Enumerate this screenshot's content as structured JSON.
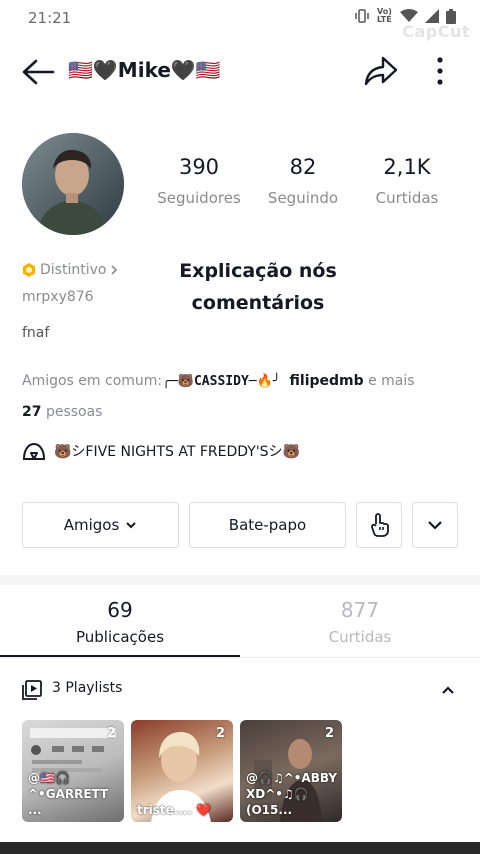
{
  "status_bar": {
    "time": "21:21",
    "net": "Vo) LTE",
    "watermark": "CapCut"
  },
  "header": {
    "title": "🇺🇸🖤Mike🖤🇺🇸"
  },
  "stats": [
    {
      "value": "390",
      "label": "Seguidores"
    },
    {
      "value": "82",
      "label": "Seguindo"
    },
    {
      "value": "2,1K",
      "label": "Curtidas"
    }
  ],
  "profile": {
    "badge": "Distintivo",
    "username": "mrpxy876",
    "bio": "fnaf",
    "overlay_line1": "Explicação nós",
    "overlay_line2": "comentários"
  },
  "mutual": {
    "prefix": "Amigos em comum:",
    "friend1": "╭─🐻CASSIDY─🔥╯",
    "friend2": "filipedmb",
    "connector": "e mais",
    "count": "27",
    "suffix": "pessoas"
  },
  "group": {
    "name": "🐻シFIVE NIGHTS AT FREDDY'Sシ🐻"
  },
  "buttons": {
    "friends": "Amigos",
    "chat": "Bate-papo"
  },
  "tabs": [
    {
      "value": "69",
      "label": "Publicações",
      "active": true
    },
    {
      "value": "877",
      "label": "Curtidas",
      "active": false
    }
  ],
  "playlists": {
    "label": "3 Playlists",
    "items": [
      {
        "count": "2",
        "title": "@🇺🇸🎧 ^•GARRETT ..."
      },
      {
        "count": "2",
        "title": "triste.... ❤️"
      },
      {
        "count": "2",
        "title": "@🎧♫^•ABBY XD^•♫🎧(O15..."
      }
    ]
  },
  "colors": {
    "text": "#161823",
    "muted": "#8a8b91",
    "border": "#dedee0",
    "badge": "#f4b400"
  }
}
